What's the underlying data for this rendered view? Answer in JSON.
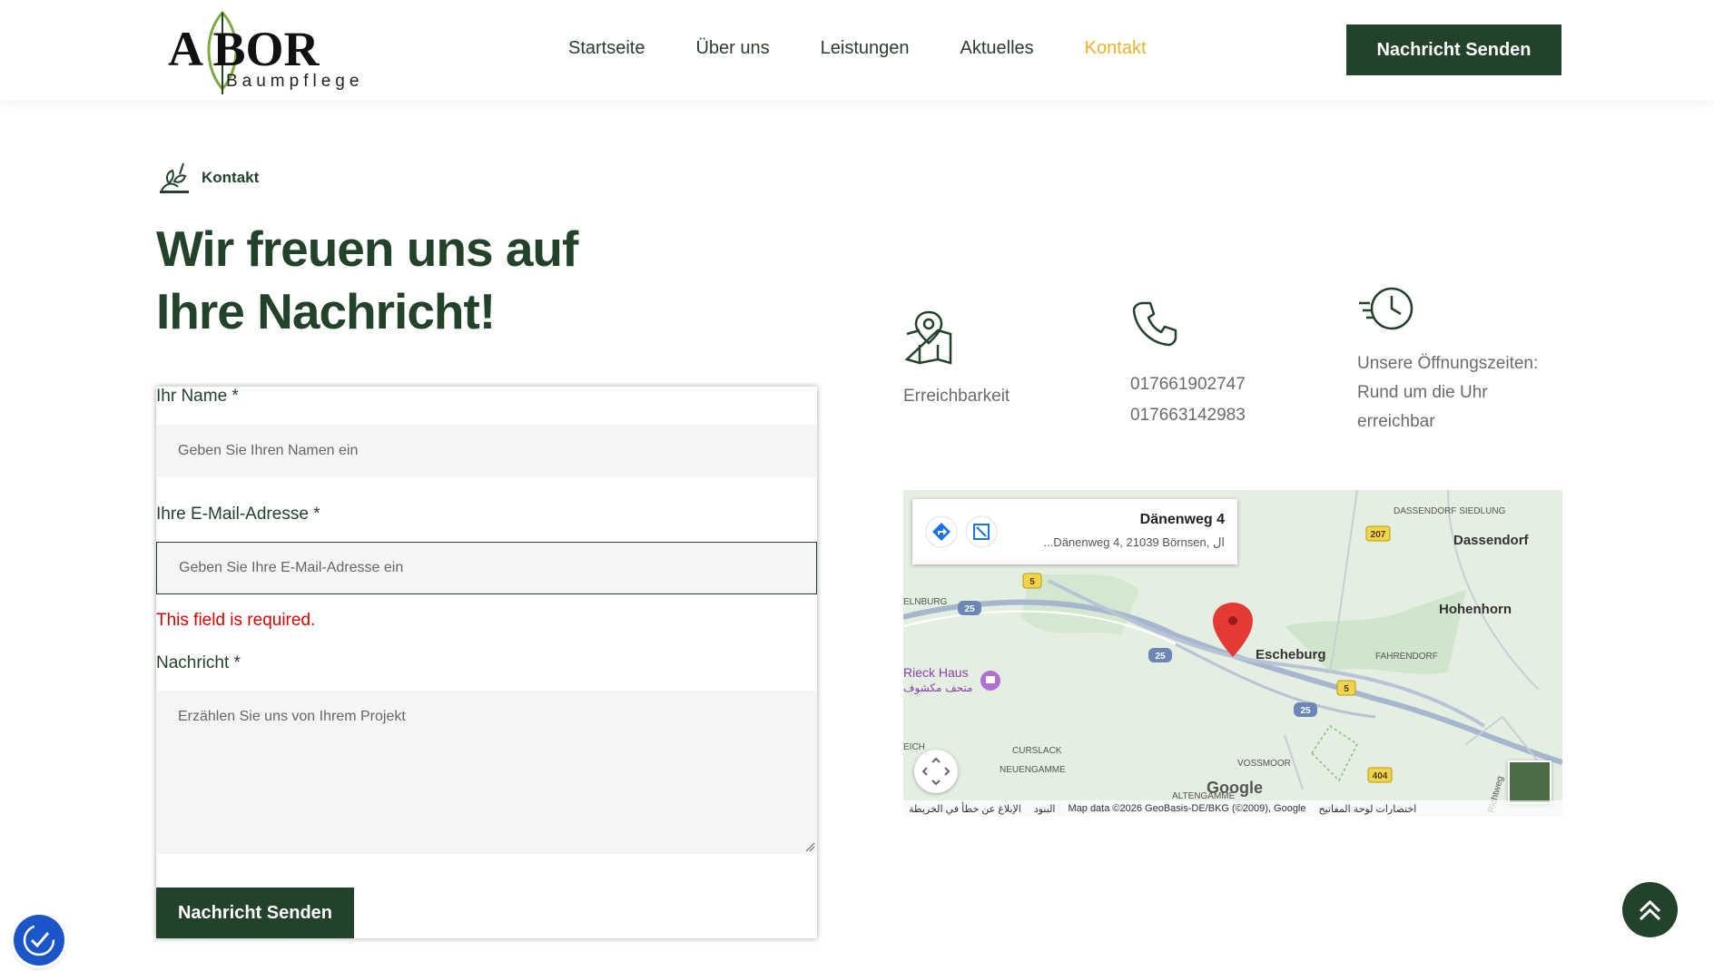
{
  "header": {
    "logo_main": "A BOR",
    "logo_sub": "Baumpflege",
    "nav": [
      "Startseite",
      "Über uns",
      "Leistungen",
      "Aktuelles",
      "Kontakt"
    ],
    "active_nav": "Kontakt",
    "cta": "Nachricht Senden"
  },
  "colors": {
    "brand": "#22422a",
    "accent": "#e9b42a",
    "error": "#d90000"
  },
  "section": {
    "eyebrow": "Kontakt",
    "headline_line1": "Wir freuen uns auf",
    "headline_line2": "Ihre Nachricht!"
  },
  "form": {
    "name_label": "Ihr Name *",
    "name_placeholder": "Geben Sie Ihren Namen ein",
    "email_label": "Ihre E-Mail-Adresse *",
    "email_placeholder": "Geben Sie Ihre E-Mail-Adresse ein",
    "email_error": "This field is required.",
    "message_label": "Nachricht *",
    "message_placeholder": "Erzählen Sie uns von Ihrem Projekt",
    "submit": "Nachricht Senden"
  },
  "info": {
    "reach_icon": "map-pin-icon",
    "reach_text": "Erreichbarkeit",
    "phone_icon": "phone-icon",
    "phone1": "017661902747",
    "phone2": "017663142983",
    "hours_icon": "clock-icon",
    "hours_line1": "Unsere Öffnungszeiten:",
    "hours_line2": "Rund um die Uhr",
    "hours_line3": "erreichbar"
  },
  "map": {
    "place_title": "Dänenweg 4",
    "place_address": "...Dänenweg 4, 21039 Börnsen, ال",
    "labels": {
      "dassendorf_siedlung": "DASSENDORF SIEDLUNG",
      "dassendorf": "Dassendorf",
      "hohenhorn": "Hohenhorn",
      "escheburg": "Escheburg",
      "fahrendorf": "FAHRENDORF",
      "rieck": "Rieck Haus",
      "rieck_ar": "متحف مكشوف",
      "curslack": "CURSLACK",
      "neuengamme": "NEUENGAMME",
      "vossmoor": "VOSSMOOR",
      "altengamme": "ALTENGAMME",
      "elnburg": "ELNBURG",
      "eich": "EICH",
      "richtweg": "Richtweg",
      "r207": "207",
      "r5a": "5",
      "r25a": "25",
      "r25b": "25",
      "r5b": "5",
      "r25c": "25",
      "r404": "404"
    },
    "google": "Google",
    "attr_report": "الإبلاغ عن خطأ في الخريطة",
    "attr_terms": "البنود",
    "attr_data": "Map data ©2026 GeoBasis-DE/BKG (©2009), Google",
    "attr_shortcuts": "اختصارات لوحة المفاتيح"
  }
}
